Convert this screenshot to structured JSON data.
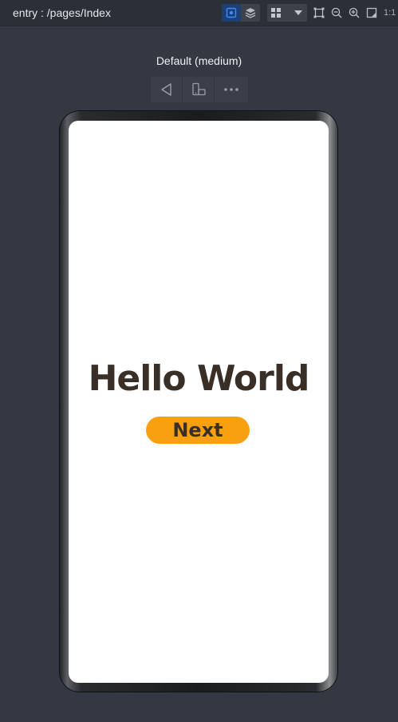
{
  "topbar": {
    "route": "entry : /pages/Index",
    "icons": [
      "inspector-icon",
      "layers-icon",
      "grid-icon",
      "chevron-down-icon",
      "fit-frame-icon",
      "zoom-out-icon",
      "zoom-in-icon",
      "fullscreen-icon"
    ],
    "ratio_label": "1:1",
    "accent": "#1c3f74"
  },
  "device": {
    "label": "Default (medium)",
    "controls": [
      "back-icon",
      "rotate-device-icon",
      "more-icon"
    ]
  },
  "app": {
    "title": "Hello World",
    "button_label": "Next",
    "button_color": "#f9a011",
    "text_color": "#3a2f27"
  }
}
